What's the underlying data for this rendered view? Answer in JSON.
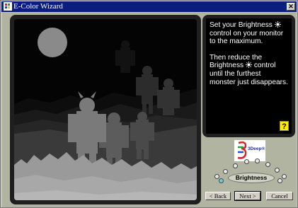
{
  "window": {
    "title": "E-Color Wizard"
  },
  "instructions": {
    "para1_text": "Set your Brightness",
    "para1_suffix": "control on your monitor to the maximum.",
    "para2_text": "Then reduce the Brightness",
    "para2_suffix": "control until the furthest monster just disappears.",
    "help_label": "?"
  },
  "brand": {
    "name": "3Deep",
    "trademark": "®"
  },
  "control": {
    "label": "Brightness",
    "knob_positions": 10,
    "active_index": 0
  },
  "buttons": {
    "back": "< Back",
    "next": "Next >",
    "cancel": "Cancel"
  },
  "colors": {
    "titlebar": "#0a1f7d",
    "help": "#ffee00",
    "active_knob": "#7ec7d8"
  }
}
